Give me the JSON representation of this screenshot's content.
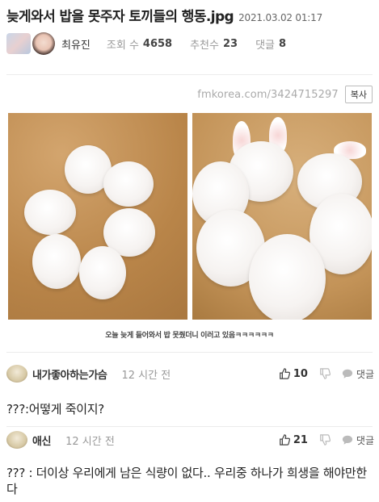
{
  "post": {
    "title": "늦게와서 밥을 못주자 토끼들의 행동.jpg",
    "date": "2021.03.02 01:17",
    "author": "최유진",
    "views_label": "조회 수",
    "views": "4658",
    "recommend_label": "추천수",
    "recommend": "23",
    "comments_label": "댓글",
    "comments": "8",
    "url": "fmkorea.com/3424715297",
    "copy_label": "복사",
    "image_caption": "오늘 늦게 들어와서 밥 못줬더니 이러고 있음ㅋㅋㅋㅋㅋㅋ"
  },
  "comments": [
    {
      "author": "내가좋아하는가슴",
      "time": "12 시간 전",
      "likes": "10",
      "reply_label": "댓글",
      "text": "???:어떻게 죽이지?"
    },
    {
      "author": "애신",
      "time": "12 시간 전",
      "likes": "21",
      "reply_label": "댓글",
      "text": "??? : 더이상 우리에게 남은 식량이 없다.. 우리중 하나가 희생을 해야만한다"
    }
  ],
  "icons": {
    "like": "thumbs-up-icon",
    "dislike": "thumbs-down-icon",
    "reply": "speech-bubble-icon"
  },
  "colors": {
    "text": "#222222",
    "muted": "#999999",
    "url": "#aaaaaa",
    "divider": "#ececec"
  }
}
